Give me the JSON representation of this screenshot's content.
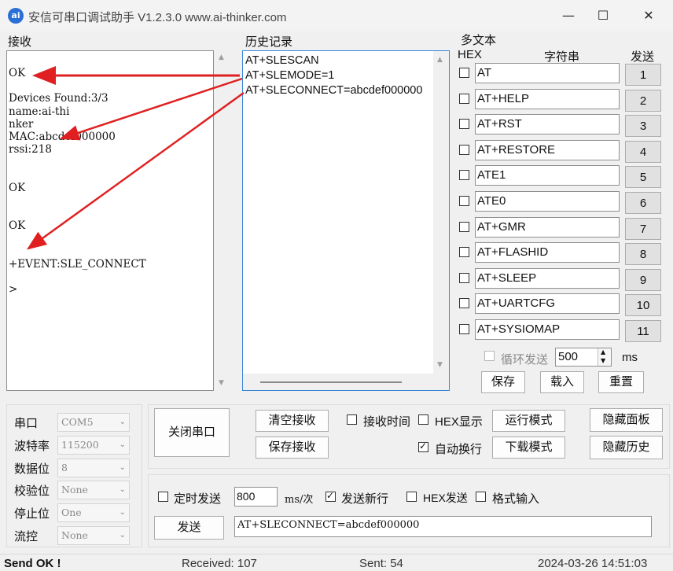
{
  "window": {
    "title": "安信可串口调试助手 V1.2.3.0    www.ai-thinker.com",
    "icon_text": "ai",
    "minimize": "—",
    "maximize": "☐",
    "close": "✕"
  },
  "receive": {
    "label": "接收",
    "lines": [
      "OK",
      "",
      "Devices Found:3/3",
      "name:ai-thi",
      "nker",
      "MAC:abcdef000000",
      "rssi:218",
      "",
      "",
      "OK",
      "",
      "",
      "OK",
      "",
      "",
      "+EVENT:SLE_CONNECT",
      "",
      ">"
    ]
  },
  "history": {
    "label": "历史记录",
    "items": [
      "AT+SLESCAN",
      "AT+SLEMODE=1",
      "AT+SLECONNECT=abcdef000000"
    ]
  },
  "multi": {
    "label": "多文本",
    "hex_header": "HEX",
    "string_header": "字符串",
    "send_header": "发送",
    "rows": [
      {
        "cmd": "AT",
        "num": "1"
      },
      {
        "cmd": "AT+HELP",
        "num": "2"
      },
      {
        "cmd": "AT+RST",
        "num": "3"
      },
      {
        "cmd": "AT+RESTORE",
        "num": "4"
      },
      {
        "cmd": "ATE1",
        "num": "5"
      },
      {
        "cmd": "ATE0",
        "num": "6"
      },
      {
        "cmd": "AT+GMR",
        "num": "7"
      },
      {
        "cmd": "AT+FLASHID",
        "num": "8"
      },
      {
        "cmd": "AT+SLEEP",
        "num": "9"
      },
      {
        "cmd": "AT+UARTCFG",
        "num": "10"
      },
      {
        "cmd": "AT+SYSIOMAP",
        "num": "11"
      }
    ],
    "loop_label": "循环发送",
    "loop_value": "500",
    "loop_unit": "ms",
    "save": "保存",
    "load": "载入",
    "reset": "重置"
  },
  "serial": {
    "port_label": "串口",
    "port_value": "COM5",
    "baud_label": "波特率",
    "baud_value": "115200",
    "data_label": "数据位",
    "data_value": "8",
    "parity_label": "校验位",
    "parity_value": "None",
    "stop_label": "停止位",
    "stop_value": "One",
    "flow_label": "流控",
    "flow_value": "None"
  },
  "controls": {
    "close_port": "关闭串口",
    "clear_recv": "清空接收",
    "save_recv": "保存接收",
    "recv_time": "接收时间",
    "hex_display": "HEX显示",
    "auto_wrap": "自动换行",
    "run_mode": "运行模式",
    "download_mode": "下载模式",
    "hide_panel": "隐藏面板",
    "hide_history": "隐藏历史"
  },
  "send": {
    "timed_send": "定时发送",
    "interval": "800",
    "interval_unit": "ms/次",
    "send_newline": "发送新行",
    "hex_send": "HEX发送",
    "format_input": "格式输入",
    "send_button": "发送",
    "input_value": "AT+SLECONNECT=abcdef000000"
  },
  "status": {
    "message": "Send OK !",
    "received": "Received: 107",
    "sent": "Sent: 54",
    "datetime": "2024-03-26 14:51:03"
  },
  "colors": {
    "arrow": "#e02020",
    "history_border": "#3a86d6"
  }
}
